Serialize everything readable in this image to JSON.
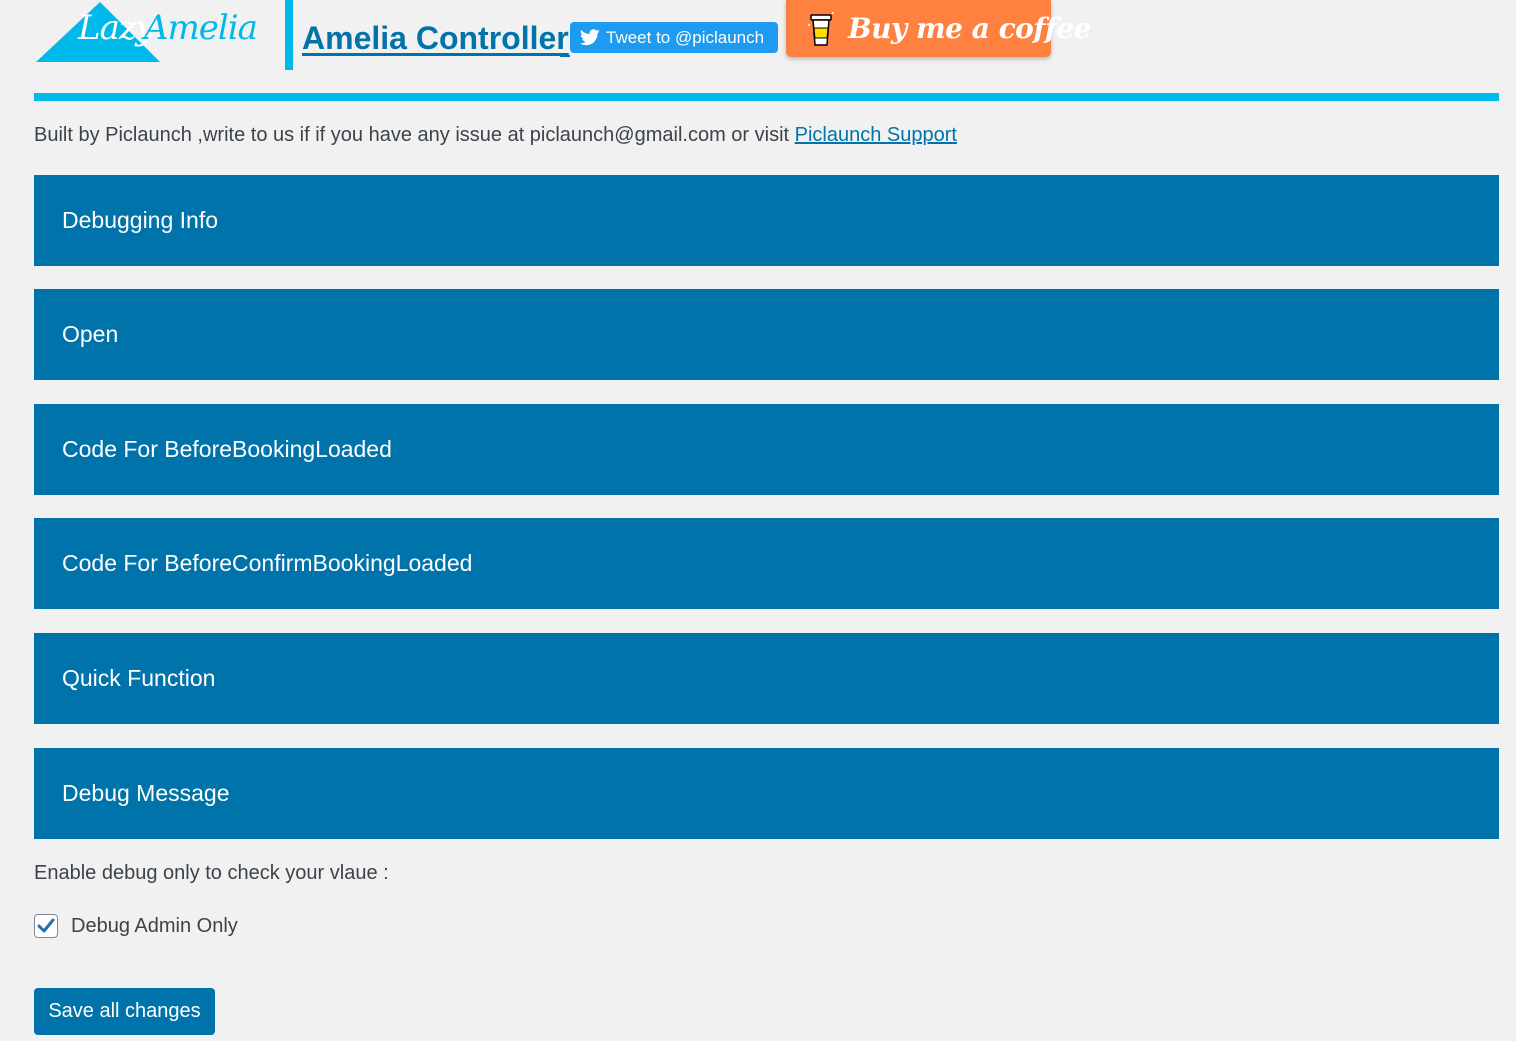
{
  "header": {
    "logo_text_lazy": "Lazy",
    "logo_text_amelia": "Amelia",
    "title": "Amelia Controller",
    "tweet_label": "Tweet to @piclaunch",
    "coffee_label": "Buy me a coffee"
  },
  "info": {
    "text": "Built by Piclaunch ,write to us if if you have any issue at piclaunch@gmail.com or visit ",
    "link_label": "Piclaunch Support"
  },
  "panels": [
    {
      "label": "Debugging Info"
    },
    {
      "label": "Open"
    },
    {
      "label": "Code For BeforeBookingLoaded"
    },
    {
      "label": "Code For BeforeConfirmBookingLoaded"
    },
    {
      "label": "Quick Function"
    },
    {
      "label": "Debug Message"
    }
  ],
  "debug": {
    "note": "Enable debug only to check your vlaue :",
    "checkbox_label": "Debug Admin Only",
    "checked": true
  },
  "save_label": "Save all changes",
  "colors": {
    "accent": "#00b9eb",
    "primary": "#0073aa",
    "coffee": "#ff813f",
    "twitter": "#1d9bf0",
    "background": "#f1f1f1"
  }
}
